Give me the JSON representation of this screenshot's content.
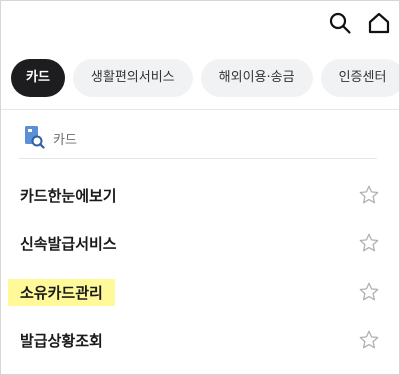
{
  "header": {
    "search_icon": "search-icon",
    "home_icon": "home-icon"
  },
  "chips": [
    {
      "label": "카드",
      "active": true
    },
    {
      "label": "생활편의서비스",
      "active": false
    },
    {
      "label": "해외이용·송금",
      "active": false
    },
    {
      "label": "인증센터",
      "active": false
    }
  ],
  "section": {
    "title": "카드",
    "icon": "card-search-icon"
  },
  "menu_items": [
    {
      "label": "카드한눈에보기",
      "highlighted": false
    },
    {
      "label": "신속발급서비스",
      "highlighted": false
    },
    {
      "label": "소유카드관리",
      "highlighted": true
    },
    {
      "label": "발급상황조회",
      "highlighted": false
    }
  ],
  "colors": {
    "active_chip_bg": "#1d1d1f",
    "chip_bg": "#f1f2f4",
    "highlight": "#fff99a",
    "section_icon": "#5b8fd6"
  }
}
